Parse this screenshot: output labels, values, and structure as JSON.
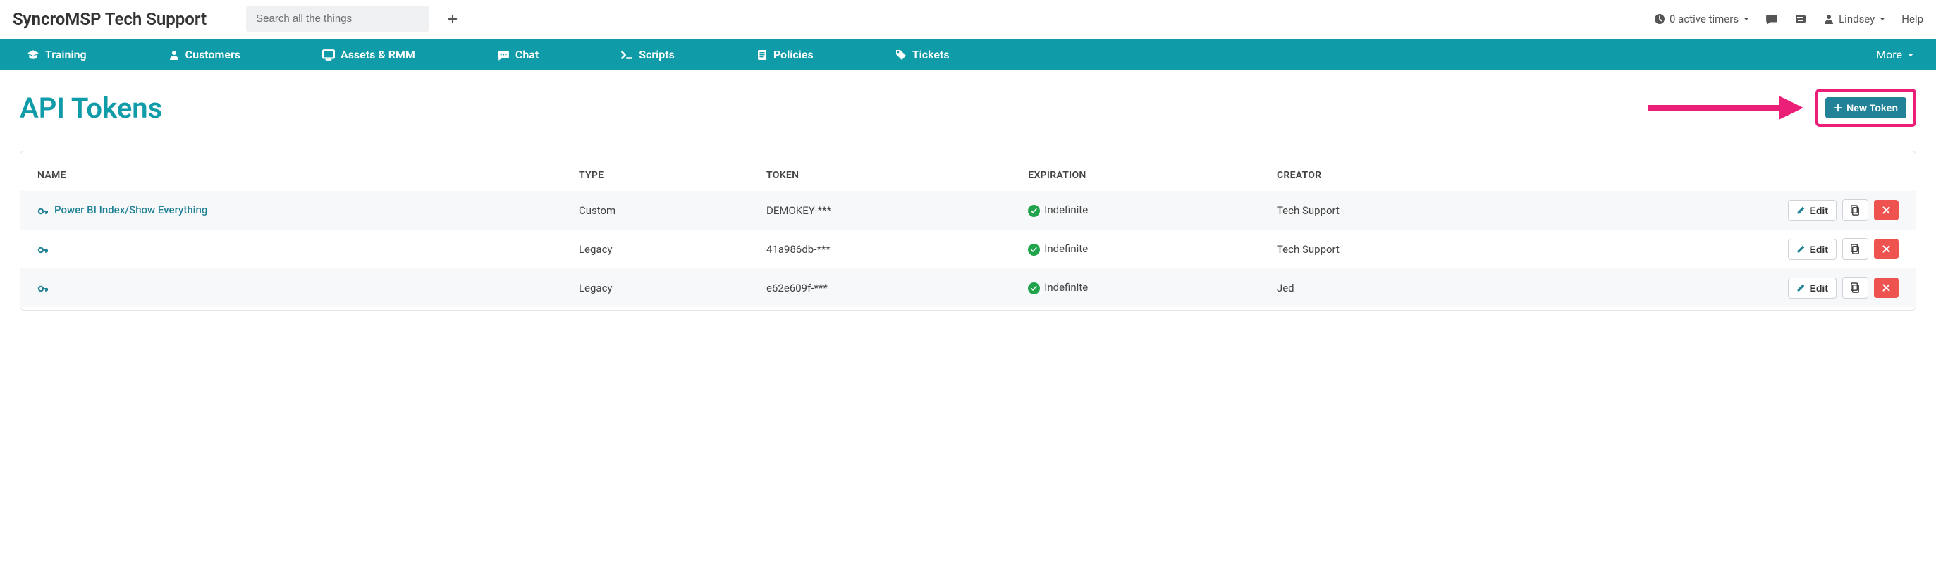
{
  "header": {
    "app_title": "SyncroMSP Tech Support",
    "search_placeholder": "Search all the things",
    "timers_label": "0 active timers",
    "user_label": "Lindsey",
    "help_label": "Help"
  },
  "nav": {
    "items": [
      {
        "label": "Training",
        "icon": "grad-cap"
      },
      {
        "label": "Customers",
        "icon": "user"
      },
      {
        "label": "Assets & RMM",
        "icon": "monitor"
      },
      {
        "label": "Chat",
        "icon": "chat"
      },
      {
        "label": "Scripts",
        "icon": "terminal"
      },
      {
        "label": "Policies",
        "icon": "doc"
      },
      {
        "label": "Tickets",
        "icon": "tag"
      }
    ],
    "more_label": "More"
  },
  "page": {
    "title": "API Tokens",
    "new_token_label": "New Token"
  },
  "table": {
    "columns": [
      "NAME",
      "TYPE",
      "TOKEN",
      "EXPIRATION",
      "CREATOR"
    ],
    "edit_label": "Edit",
    "rows": [
      {
        "name": "Power BI Index/Show Everything",
        "name_is_link": true,
        "type": "Custom",
        "token": "DEMOKEY-***",
        "expiration": "Indefinite",
        "creator": "Tech Support"
      },
      {
        "name": "",
        "name_is_link": false,
        "type": "Legacy",
        "token": "41a986db-***",
        "expiration": "Indefinite",
        "creator": "Tech Support"
      },
      {
        "name": "",
        "name_is_link": false,
        "type": "Legacy",
        "token": "e62e609f-***",
        "expiration": "Indefinite",
        "creator": "Jed"
      }
    ]
  }
}
